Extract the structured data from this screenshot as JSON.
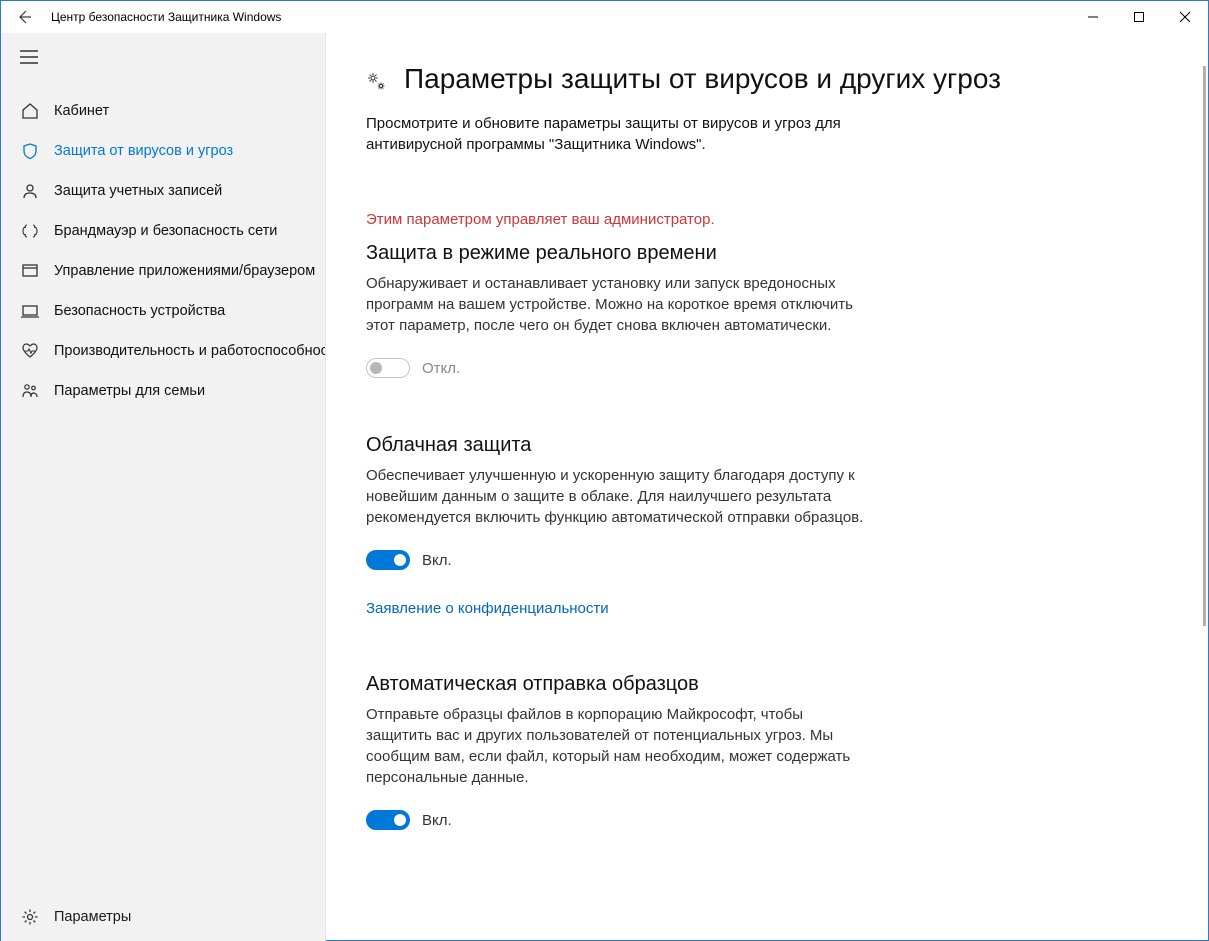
{
  "window": {
    "title": "Центр безопасности Защитника Windows"
  },
  "sidebar": {
    "items": [
      {
        "label": "Кабинет"
      },
      {
        "label": "Защита от вирусов и угроз"
      },
      {
        "label": "Защита учетных записей"
      },
      {
        "label": "Брандмауэр и безопасность сети"
      },
      {
        "label": "Управление приложениями/браузером"
      },
      {
        "label": "Безопасность устройства"
      },
      {
        "label": "Производительность и работоспособность"
      },
      {
        "label": "Параметры для семьи"
      }
    ],
    "footer": {
      "label": "Параметры"
    }
  },
  "main": {
    "title": "Параметры защиты от вирусов и других угроз",
    "subtitle": "Просмотрите и обновите параметры защиты от вирусов и угроз для антивирусной программы \"Защитника Windows\".",
    "sections": [
      {
        "admin_note": "Этим параметром управляет ваш администратор.",
        "title": "Защита в режиме реального времени",
        "desc": "Обнаруживает и останавливает установку или запуск вредоносных программ на вашем устройстве. Можно на короткое время отключить этот параметр, после чего он будет снова включен автоматически.",
        "toggle_state": "Откл.",
        "link": ""
      },
      {
        "admin_note": "",
        "title": "Облачная защита",
        "desc": "Обеспечивает улучшенную и ускоренную защиту благодаря доступу к новейшим данным о защите в облаке. Для наилучшего результата рекомендуется включить функцию автоматической отправки образцов.",
        "toggle_state": "Вкл.",
        "link": "Заявление о конфиденциальности"
      },
      {
        "admin_note": "",
        "title": "Автоматическая отправка образцов",
        "desc": "Отправьте образцы файлов в корпорацию Майкрософт, чтобы защитить вас и других пользователей от потенциальных угроз. Мы сообщим вам, если файл, который нам необходим, может содержать персональные данные.",
        "toggle_state": "Вкл.",
        "link": ""
      }
    ]
  }
}
